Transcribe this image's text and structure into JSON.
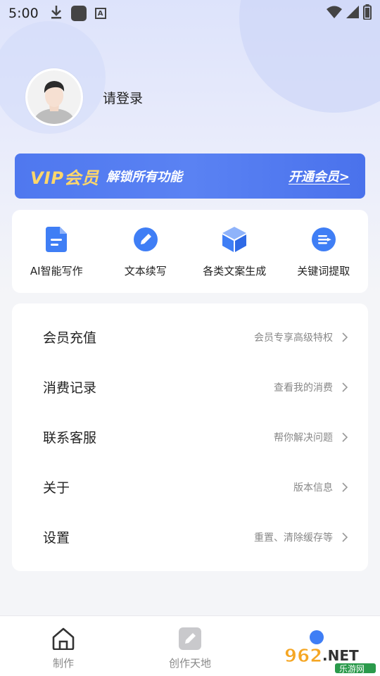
{
  "status_bar": {
    "time": "5:00"
  },
  "profile": {
    "login_text": "请登录"
  },
  "vip_banner": {
    "title": "VIP会员",
    "subtitle": "解锁所有功能",
    "open_label": "开通会员>"
  },
  "tools": [
    {
      "label": "AI智能写作",
      "icon": "document-icon"
    },
    {
      "label": "文本续写",
      "icon": "pen-icon"
    },
    {
      "label": "各类文案生成",
      "icon": "cube-icon"
    },
    {
      "label": "关键词提取",
      "icon": "list-icon"
    }
  ],
  "menu": [
    {
      "label": "会员充值",
      "desc": "会员专享高级特权"
    },
    {
      "label": "消费记录",
      "desc": "查看我的消费"
    },
    {
      "label": "联系客服",
      "desc": "帮你解决问题"
    },
    {
      "label": "关于",
      "desc": "版本信息"
    },
    {
      "label": "设置",
      "desc": "重置、清除缓存等"
    }
  ],
  "bottom_nav": [
    {
      "label": "制作",
      "icon": "home-icon"
    },
    {
      "label": "创作天地",
      "icon": "edit-icon"
    },
    {
      "label": "",
      "icon": "profile-icon"
    }
  ],
  "watermark": {
    "text": "962.NET",
    "sub": "乐游网"
  },
  "colors": {
    "accent": "#4a7cf0",
    "vip_gold": "#ffd76a",
    "background": "#f4f5f8"
  }
}
